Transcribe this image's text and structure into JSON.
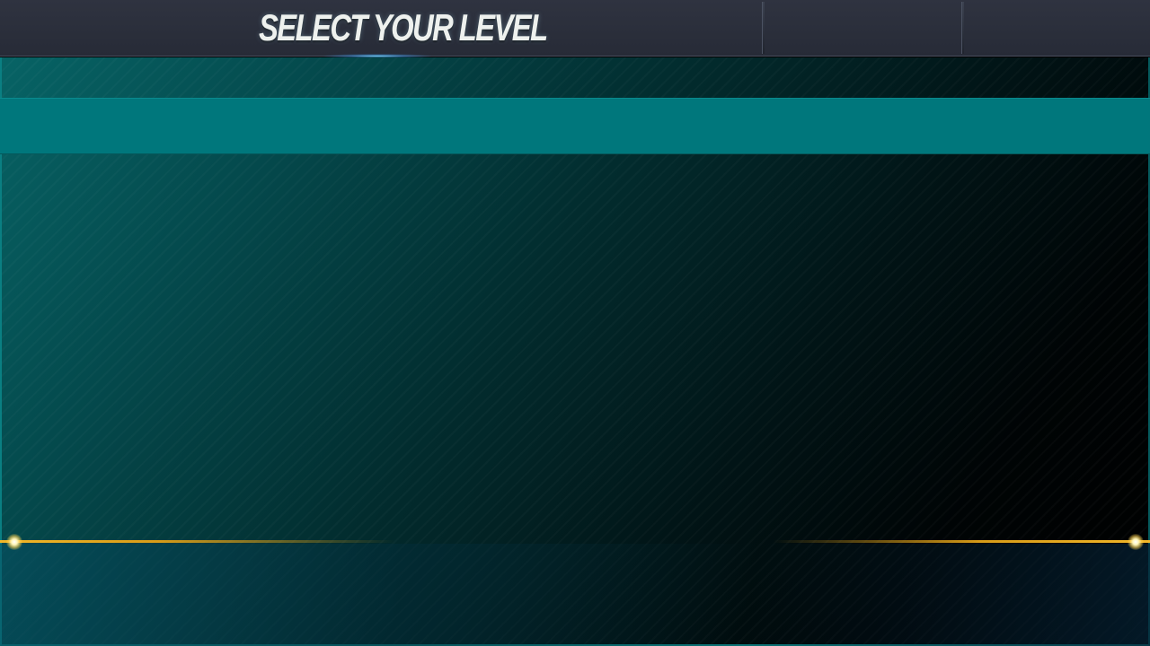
{
  "topbar": {
    "title": "SELECT YOUR LEVEL",
    "tabs": [
      "",
      ""
    ]
  },
  "colors": {
    "topbar_bg": "#2b2f3b",
    "title_text": "#eef1ee",
    "panel_teal": "#076365",
    "header_band": "#00777c",
    "gold_accent": "#f2b728"
  },
  "icons": {
    "title_glow": "blue-glow",
    "divider_sparks": "spark-icon"
  }
}
